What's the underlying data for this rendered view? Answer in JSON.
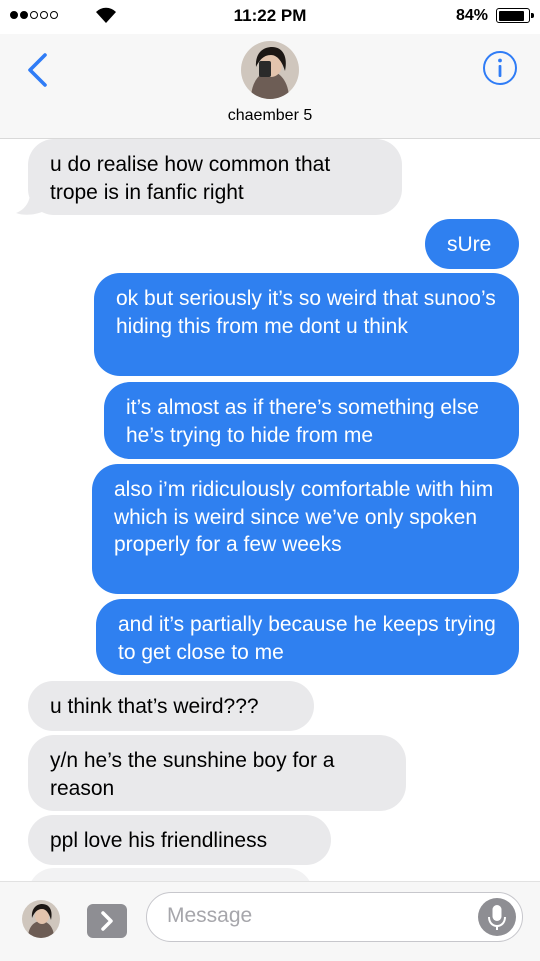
{
  "status_bar": {
    "time": "11:22 PM",
    "battery": "84%"
  },
  "header": {
    "contact_name": "chaember 5",
    "back_icon": "chevron-left-icon",
    "info_icon": "info-icon"
  },
  "messages": [
    {
      "direction": "received",
      "text": "u do realise how common that trope is in fanfic right"
    },
    {
      "direction": "sent",
      "text": "sUre"
    },
    {
      "direction": "sent",
      "text": "ok but seriously it’s so weird that sunoo’s hiding this from me dont u think"
    },
    {
      "direction": "sent",
      "text": "it’s almost as if there’s something else he’s trying to hide from me"
    },
    {
      "direction": "sent",
      "text": "also i’m ridiculously comfortable with him which is weird since we’ve only spoken properly for a few weeks"
    },
    {
      "direction": "sent",
      "text": "and it’s partially because he keeps trying to get close to me"
    },
    {
      "direction": "received",
      "text": "u think that’s weird???"
    },
    {
      "direction": "received",
      "text": "y/n he’s the sunshine boy for a reason"
    },
    {
      "direction": "received",
      "text": "ppl love his friendliness"
    }
  ],
  "composer": {
    "placeholder": "Message",
    "apps_icon": "app-store-icon",
    "mic_icon": "microphone-icon"
  },
  "colors": {
    "sent_bubble": "#2f80f0",
    "received_bubble": "#e9e9eb",
    "accent": "#2f7cf6"
  }
}
